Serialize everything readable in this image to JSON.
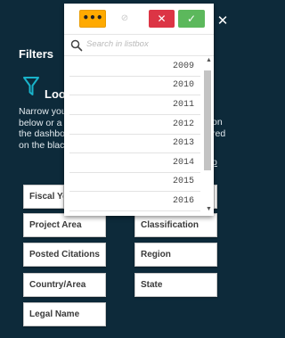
{
  "filters_title": "Filters",
  "heading": "Loo",
  "description_left": "Narrow you\nbelow or a\nthe dashbo\non the blac",
  "description_right": "on\nred",
  "description_link": "p",
  "filter_buttons": [
    "Fiscal Yea",
    "Project Area",
    "Classification",
    "Posted Citations",
    "Region",
    "Country/Area",
    "State",
    "Legal Name"
  ],
  "listbox": {
    "more_label": "•••",
    "clear_label": "⊘",
    "cancel_label": "✕",
    "confirm_label": "✓",
    "search_placeholder": "Search in listbox",
    "items": [
      "2009",
      "2010",
      "2011",
      "2012",
      "2013",
      "2014",
      "2015",
      "2016"
    ]
  },
  "colors": {
    "background": "#0d2a3a",
    "more_button": "#ffaa00",
    "cancel_button": "#dc3545",
    "confirm_button": "#5cb85c"
  },
  "icons": [
    "close-icon",
    "filter-funnel-icon",
    "search-icon",
    "more-options-icon",
    "clear-selection-icon",
    "cancel-icon",
    "confirm-icon"
  ]
}
